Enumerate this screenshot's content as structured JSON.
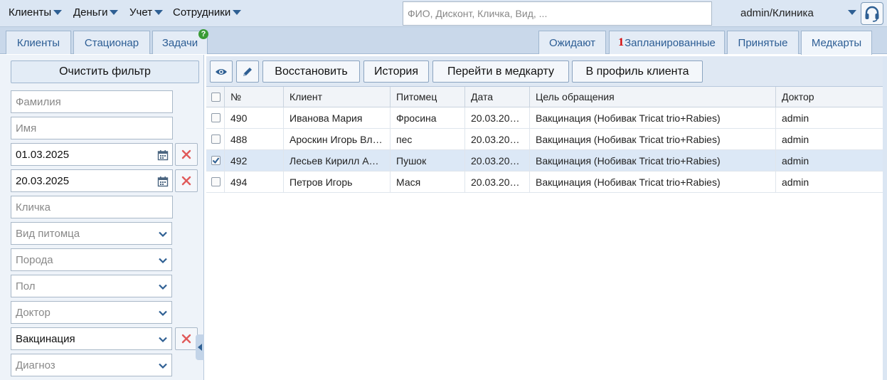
{
  "menu": [
    {
      "label": "Клиенты"
    },
    {
      "label": "Деньги"
    },
    {
      "label": "Учет"
    },
    {
      "label": "Сотрудники"
    }
  ],
  "search": {
    "placeholder": "ФИО, Дисконт, Кличка, Вид, ..."
  },
  "user": {
    "label": "admin/Клиника"
  },
  "tabs_left": [
    "Клиенты",
    "Стационар",
    "Задачи"
  ],
  "tasks_badge": "?",
  "tabs_right": {
    "waiting": "Ожидают",
    "planned_count": "1",
    "planned": "Запланированные",
    "accepted": "Принятые",
    "medcards": "Медкарты"
  },
  "filter": {
    "clear": "Очистить фильтр",
    "surname_placeholder": "Фамилия",
    "name_placeholder": "Имя",
    "date_from": "01.03.2025",
    "date_to": "20.03.2025",
    "nickname_placeholder": "Кличка",
    "species": "Вид питомца",
    "breed": "Порода",
    "sex": "Пол",
    "doctor": "Доктор",
    "purpose": "Вакцинация",
    "diagnosis": "Диагноз"
  },
  "toolbar": {
    "restore": "Восстановить",
    "history": "История",
    "goto_card": "Перейти в медкарту",
    "to_profile": "В профиль клиента"
  },
  "columns": [
    "№",
    "Клиент",
    "Питомец",
    "Дата",
    "Цель обращения",
    "Доктор"
  ],
  "rows": [
    {
      "checked": false,
      "num": "490",
      "client": "Иванова Мария",
      "pet": "Фросина",
      "date": "20.03.20…",
      "purpose": "Вакцинация (Нобивак Tricat trio+Rabies)",
      "doctor": "admin"
    },
    {
      "checked": false,
      "num": "488",
      "client": "Ароскин Игорь Вл…",
      "pet": "пес",
      "date": "20.03.20…",
      "purpose": "Вакцинация (Нобивак Tricat trio+Rabies)",
      "doctor": "admin"
    },
    {
      "checked": true,
      "num": "492",
      "client": "Лесьев Кирилл А…",
      "pet": "Пушок",
      "date": "20.03.20…",
      "purpose": "Вакцинация (Нобивак Tricat trio+Rabies)",
      "doctor": "admin"
    },
    {
      "checked": false,
      "num": "494",
      "client": "Петров Игорь",
      "pet": "Мася",
      "date": "20.03.20…",
      "purpose": "Вакцинация (Нобивак Tricat trio+Rabies)",
      "doctor": "admin"
    }
  ],
  "colors": {
    "accent": "#2c5d94",
    "badge": "#3a9b35",
    "count": "#d40000",
    "clear_x": "#e05a5a"
  }
}
